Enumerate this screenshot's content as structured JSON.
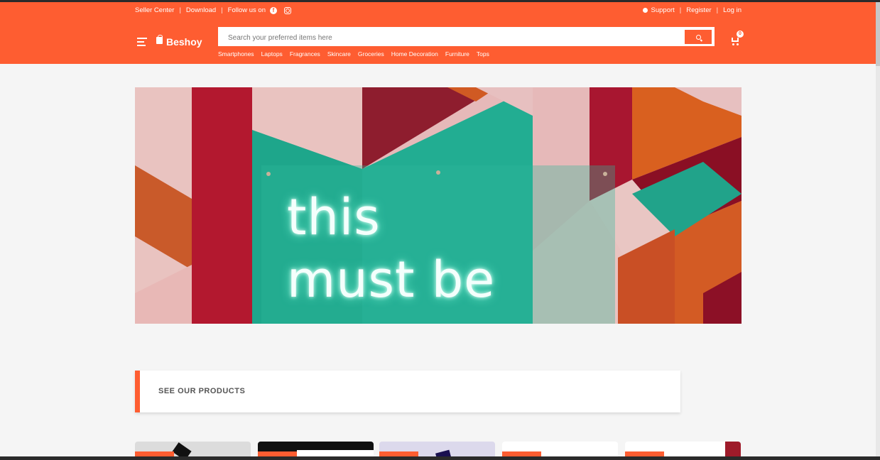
{
  "header": {
    "top_links": {
      "seller_center": "Seller Center",
      "download": "Download",
      "follow_us": "Follow us on",
      "facebook_icon": "facebook-icon",
      "instagram_icon": "instagram-icon"
    },
    "right_links": {
      "support": "Support",
      "register": "Register",
      "login": "Log in"
    },
    "brand": "Beshoy",
    "search": {
      "placeholder": "Search your preferred items here"
    },
    "cart": {
      "count": "0"
    },
    "categories": [
      "Smartphones",
      "Laptops",
      "Fragrances",
      "Skincare",
      "Groceries",
      "Home Decoration",
      "Furniture",
      "Tops"
    ]
  },
  "hero": {
    "line1": "this",
    "line2": "must be"
  },
  "products_section": {
    "title": "SEE OUR PRODUCTS"
  },
  "colors": {
    "brand": "#fe5d31",
    "background": "#f5f5f5",
    "hero_teal": "#23a88c"
  }
}
